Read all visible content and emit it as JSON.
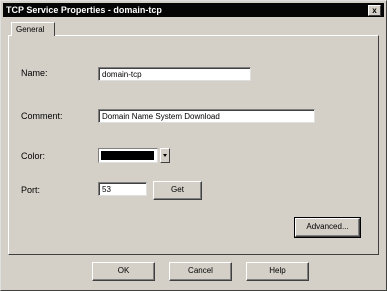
{
  "window": {
    "title": "TCP Service Properties - domain-tcp",
    "close_glyph": "x"
  },
  "tabs": [
    {
      "label": "General",
      "selected": true
    }
  ],
  "form": {
    "name": {
      "label": "Name:",
      "value": "domain-tcp"
    },
    "comment": {
      "label": "Comment:",
      "value": "Domain Name System Download"
    },
    "color": {
      "label": "Color:",
      "value": "#000000"
    },
    "port": {
      "label": "Port:",
      "value": "53"
    },
    "get_button": "Get",
    "advanced_button": "Advanced..."
  },
  "footer": {
    "ok": "OK",
    "cancel": "Cancel",
    "help": "Help"
  }
}
